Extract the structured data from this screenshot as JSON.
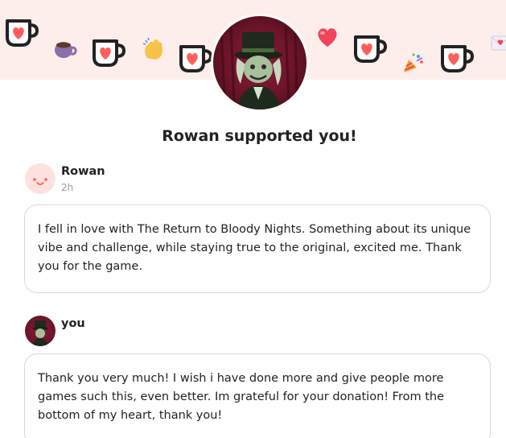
{
  "banner": {
    "icons": [
      "kofi-cup-icon",
      "coffee-emoji-icon",
      "clapping-hands-icon",
      "heart-icon",
      "party-popper-icon",
      "love-letter-icon"
    ],
    "accent_color": "#ff5e5b",
    "background_color": "#fdeeec"
  },
  "supporter_title": "Rowan supported you!",
  "messages": [
    {
      "author": "Rowan",
      "time": "2h",
      "text": "I fell in love with The Return to Bloody Nights. Something about its unique vibe and challenge, while staying true to the original, excited me. Thank you for the game."
    },
    {
      "author": "you",
      "time": "",
      "text": "Thank you very much! I wish i have done more and give people more games such this, even better. Im grateful for your donation! From the bottom of my heart, thank you!"
    }
  ]
}
